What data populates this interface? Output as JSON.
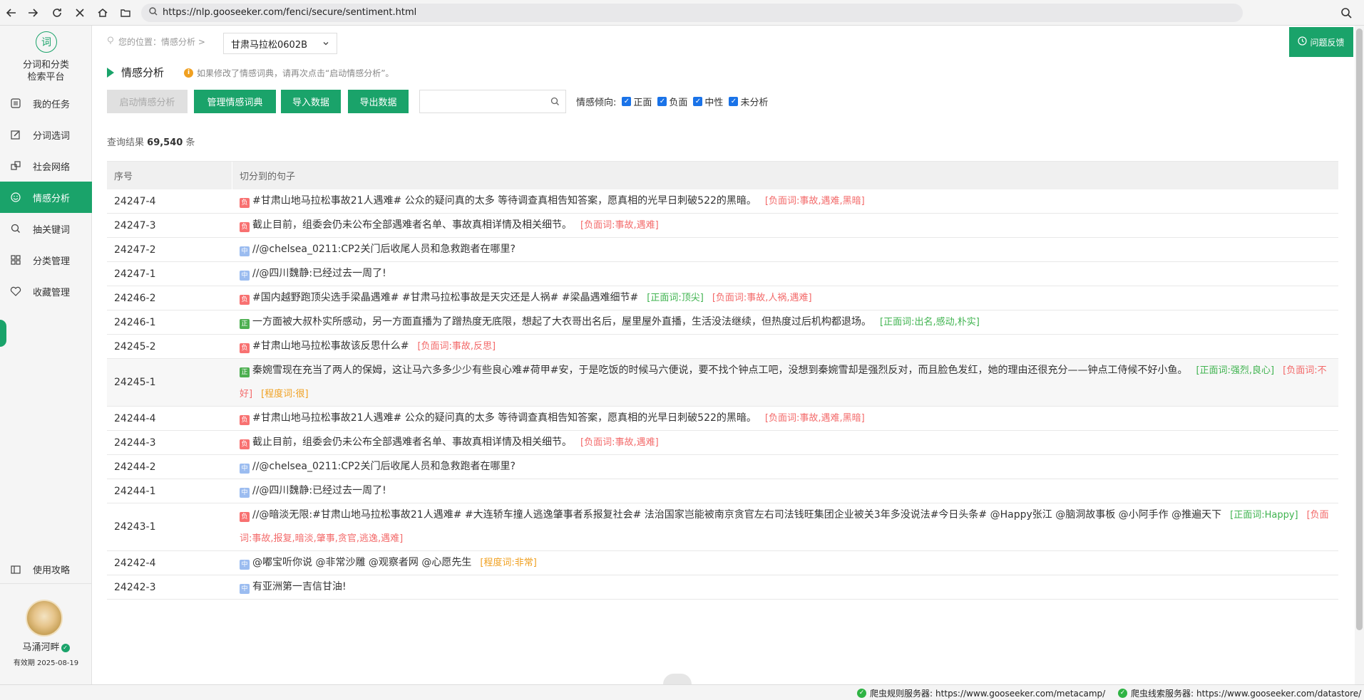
{
  "browser": {
    "url": "https://nlp.gooseeker.com/fenci/secure/sentiment.html"
  },
  "sidebar": {
    "logo_char": "词",
    "logo_line1": "分词和分类",
    "logo_line2": "检索平台",
    "items": [
      {
        "label": "我的任务",
        "icon": "list-icon"
      },
      {
        "label": "分词选词",
        "icon": "edit-icon"
      },
      {
        "label": "社会网络",
        "icon": "network-icon"
      },
      {
        "label": "情感分析",
        "icon": "smile-icon",
        "active": true
      },
      {
        "label": "抽关键词",
        "icon": "search-icon"
      },
      {
        "label": "分类管理",
        "icon": "grid-icon"
      },
      {
        "label": "收藏管理",
        "icon": "heart-icon"
      }
    ],
    "guide_label": "使用攻略",
    "username": "马涌河畔",
    "validity": "有效期 2025-08-19"
  },
  "header": {
    "breadcrumb": "您的位置：情感分析 >",
    "project": "甘肃马拉松0602B",
    "feedback": "问题反馈"
  },
  "section": {
    "title": "情感分析",
    "hint": "如果修改了情感词典，请再次点击“启动情感分析”。"
  },
  "toolbar": {
    "start": "启动情感分析",
    "manage_dict": "管理情感词典",
    "import": "导入数据",
    "export": "导出数据",
    "search_value": "",
    "filter_label": "情感倾向:",
    "filters": [
      "正面",
      "负面",
      "中性",
      "未分析"
    ]
  },
  "results": {
    "prefix": "查询结果",
    "count": "69,540",
    "suffix": "条"
  },
  "table": {
    "headers": [
      "序号",
      "切分到的句子"
    ],
    "rows": [
      {
        "id": "24247-4",
        "tag": "负",
        "type": "neg",
        "text": "#甘肃山地马拉松事故21人遇难# 公众的疑问真的太多 等待调查真相告知答案，愿真相的光早日刺破522的黑暗。",
        "anns": [
          {
            "type": "neg",
            "text": "[负面词:事故,遇难,黑暗]"
          }
        ]
      },
      {
        "id": "24247-3",
        "tag": "负",
        "type": "neg",
        "text": "截止目前，组委会仍未公布全部遇难者名单、事故真相详情及相关细节。",
        "anns": [
          {
            "type": "neg",
            "text": "[负面词:事故,遇难]"
          }
        ]
      },
      {
        "id": "24247-2",
        "tag": "中",
        "type": "neu",
        "text": "//@chelsea_0211:CP2关门后收尾人员和急救跑者在哪里?",
        "anns": []
      },
      {
        "id": "24247-1",
        "tag": "中",
        "type": "neu",
        "text": "//@四川魏静:已经过去一周了!",
        "anns": []
      },
      {
        "id": "24246-2",
        "tag": "负",
        "type": "neg",
        "text": "#国内越野跑顶尖选手梁晶遇难# #甘肃马拉松事故是天灾还是人祸# #梁晶遇难细节#",
        "anns": [
          {
            "type": "pos",
            "text": "[正面词:顶尖]"
          },
          {
            "type": "neg",
            "text": "[负面词:事故,人祸,遇难]"
          }
        ]
      },
      {
        "id": "24246-1",
        "tag": "正",
        "type": "pos",
        "text": "一方面被大叔朴实所感动，另一方面直播为了蹭热度无底限，想起了大衣哥出名后，屋里屋外直播，生活没法继续，但热度过后机构都退场。",
        "anns": [
          {
            "type": "pos",
            "text": "[正面词:出名,感动,朴实]"
          }
        ]
      },
      {
        "id": "24245-2",
        "tag": "负",
        "type": "neg",
        "text": "#甘肃山地马拉松事故该反思什么#",
        "anns": [
          {
            "type": "neg",
            "text": "[负面词:事故,反思]"
          }
        ]
      },
      {
        "id": "24245-1",
        "tag": "正",
        "type": "pos",
        "double": true,
        "alt": true,
        "text": "秦婉雪现在充当了两人的保姆，这让马六多多少少有些良心难#荷甲#安，于是吃饭的时候马六便说，要不找个钟点工吧，没想到秦婉雪却是强烈反对，而且脸色发红，她的理由还很充分——钟点工侍候不好小鱼。",
        "anns": [
          {
            "type": "pos",
            "text": "[正面词:强烈,良心]"
          },
          {
            "type": "neg",
            "text": "[负面词:不好]"
          },
          {
            "type": "deg",
            "text": "[程度词:很]"
          }
        ]
      },
      {
        "id": "24244-4",
        "tag": "负",
        "type": "neg",
        "text": "#甘肃山地马拉松事故21人遇难# 公众的疑问真的太多 等待调查真相告知答案，愿真相的光早日刺破522的黑暗。",
        "anns": [
          {
            "type": "neg",
            "text": "[负面词:事故,遇难,黑暗]"
          }
        ]
      },
      {
        "id": "24244-3",
        "tag": "负",
        "type": "neg",
        "text": "截止目前，组委会仍未公布全部遇难者名单、事故真相详情及相关细节。",
        "anns": [
          {
            "type": "neg",
            "text": "[负面词:事故,遇难]"
          }
        ]
      },
      {
        "id": "24244-2",
        "tag": "中",
        "type": "neu",
        "text": "//@chelsea_0211:CP2关门后收尾人员和急救跑者在哪里?",
        "anns": []
      },
      {
        "id": "24244-1",
        "tag": "中",
        "type": "neu",
        "text": "//@四川魏静:已经过去一周了!",
        "anns": []
      },
      {
        "id": "24243-1",
        "tag": "负",
        "type": "neg",
        "double": true,
        "text": "//@暗淡无限:#甘肃山地马拉松事故21人遇难# #大连轿车撞人逃逸肇事者系报复社会# 法治国家岂能被南京贪官左右司法钱旺集团企业被关3年多没说法#今日头条# @Happy张江 @脑洞故事板 @小阿手作 @推遍天下",
        "anns": [
          {
            "type": "pos",
            "text": "[正面词:Happy]"
          },
          {
            "type": "neg",
            "text": "[负面词:事故,报复,暗淡,肇事,贪官,逃逸,遇难]"
          }
        ]
      },
      {
        "id": "24242-4",
        "tag": "中",
        "type": "neu",
        "text": "@嘟宝听你说 @非常沙雕 @观察者网 @心愿先生",
        "anns": [
          {
            "type": "deg",
            "text": "[程度词:非常]"
          }
        ]
      },
      {
        "id": "24242-3",
        "tag": "中",
        "type": "neu",
        "text": "有亚洲第一吉信甘油!",
        "anns": []
      }
    ]
  },
  "status": {
    "rule_label": "爬虫规则服务器:",
    "rule_url": "https://www.gooseeker.com/metacamp/",
    "clue_label": "爬虫线索服务器:",
    "clue_url": "https://www.gooseeker.com/datastore/"
  },
  "colors": {
    "accent": "#1aa36a",
    "negative": "#f36a6a",
    "positive": "#3fb34f",
    "degree": "#f0a020",
    "neutral_tag": "#9bbcf0"
  }
}
